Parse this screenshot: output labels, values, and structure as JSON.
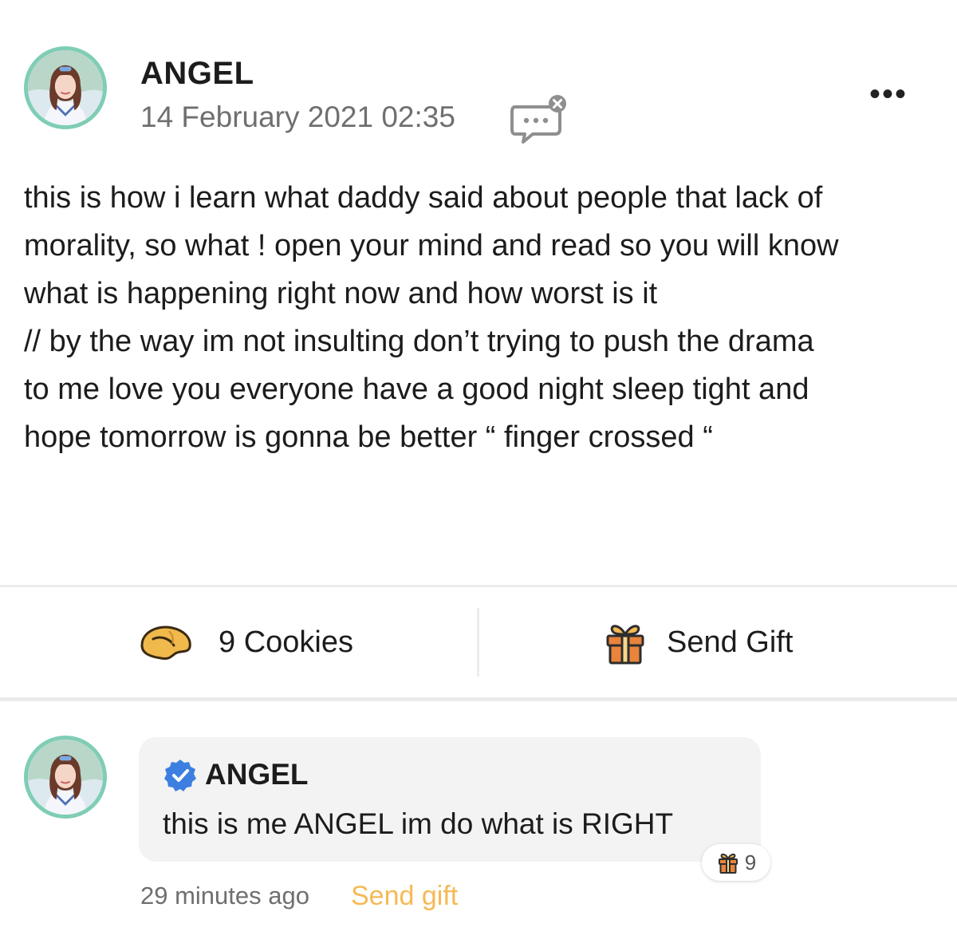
{
  "post": {
    "author": "ANGEL",
    "date": "14 February 2021 02:35",
    "body_lines": [
      "this is how i learn what daddy said about people that lack of",
      "morality, so what ! open your mind and read so you will know",
      "what is happening right now and how worst is it",
      "// by the way im not insulting don’t trying to push the drama",
      "to me love you everyone have a good night sleep tight and",
      "hope tomorrow is gonna be better “ finger crossed “"
    ]
  },
  "actions": {
    "cookies_label": "9 Cookies",
    "gift_label": "Send Gift"
  },
  "comment": {
    "author": "ANGEL",
    "text": "this is me ANGEL im do what is RIGHT",
    "gift_count": "9",
    "time": "29 minutes ago",
    "send_gift_label": "Send gift"
  },
  "colors": {
    "avatar_ring": "#7fcdb5",
    "verified": "#3d7fe0",
    "send_gift_link": "#f6b955",
    "muted_text": "#6f6f6f",
    "bubble_bg": "#f3f3f3"
  },
  "icons": {
    "post_avatar": "avatar",
    "comment_status": "comment-disabled-icon",
    "more": "more-dots-icon",
    "cookies": "fortune-cookie-icon",
    "gift": "gift-icon",
    "verified": "verified-badge-icon"
  }
}
